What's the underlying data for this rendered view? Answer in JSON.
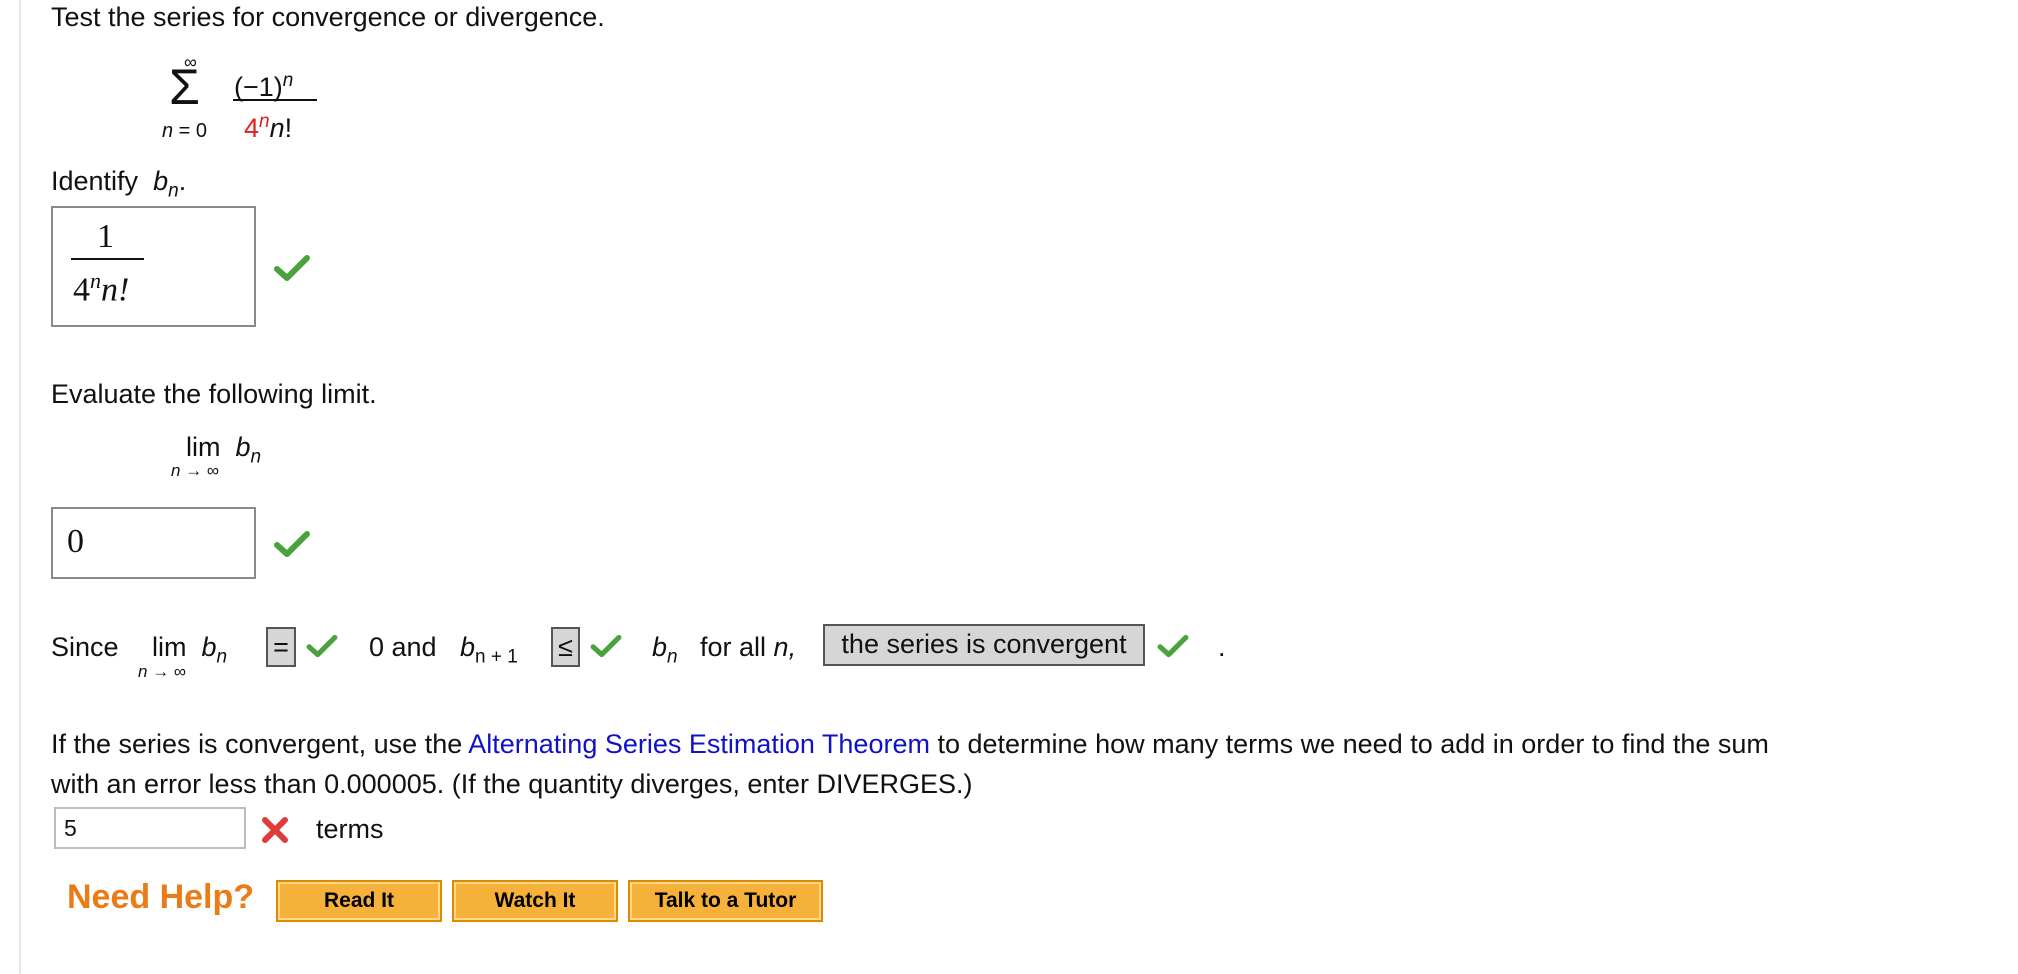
{
  "question": {
    "instruction": "Test the series for convergence or divergence.",
    "series": {
      "sigma": "Σ",
      "upper": "∞",
      "lower": "n = 0",
      "numerator": "(−1)",
      "numerator_exp": "n",
      "denominator_base": "4",
      "denominator_exp": "n",
      "denominator_rest": "n!"
    },
    "identify_label": "Identify",
    "identify_var": "b",
    "identify_sub": "n",
    "identify_end": ".",
    "bn_answer": {
      "numerator": "1",
      "den_base": "4",
      "den_exp": "n",
      "den_rest": "n!"
    },
    "evaluate_label": "Evaluate the following limit.",
    "limit": {
      "lim": "lim",
      "under": "n → ∞",
      "var": "b",
      "sub": "n"
    },
    "limit_answer": "0",
    "since": {
      "since": "Since",
      "lim": "lim",
      "under": "n → ∞",
      "var": "b",
      "sub": "n",
      "eq_select": "=",
      "and_text": "0 and",
      "var2": "b",
      "sub2": "n + 1",
      "le_select": "≤",
      "var3": "b",
      "sub3": "n",
      "for_all": "for all",
      "n": "n,",
      "conclusion_select": "the series is convergent",
      "period": "."
    },
    "estimation": {
      "pre": "If the series is convergent, use the",
      "link": "Alternating Series Estimation Theorem",
      "post": "to determine how many terms we need to add in order to find the sum",
      "line2": "with an error less than 0.000005. (If the quantity diverges, enter DIVERGES.)",
      "input_value": "5",
      "unit": "terms"
    },
    "help": {
      "label": "Need Help?",
      "buttons": [
        "Read It",
        "Watch It",
        "Talk to a Tutor"
      ]
    }
  },
  "colors": {
    "check": "#4aa23c",
    "wrong": "#e03b3b",
    "link": "#1111c6",
    "help": "#ea7b16",
    "button": "#f6b13a",
    "red_text": "#e0201b"
  },
  "icons": {
    "correct": "check-icon",
    "incorrect": "x-icon"
  }
}
